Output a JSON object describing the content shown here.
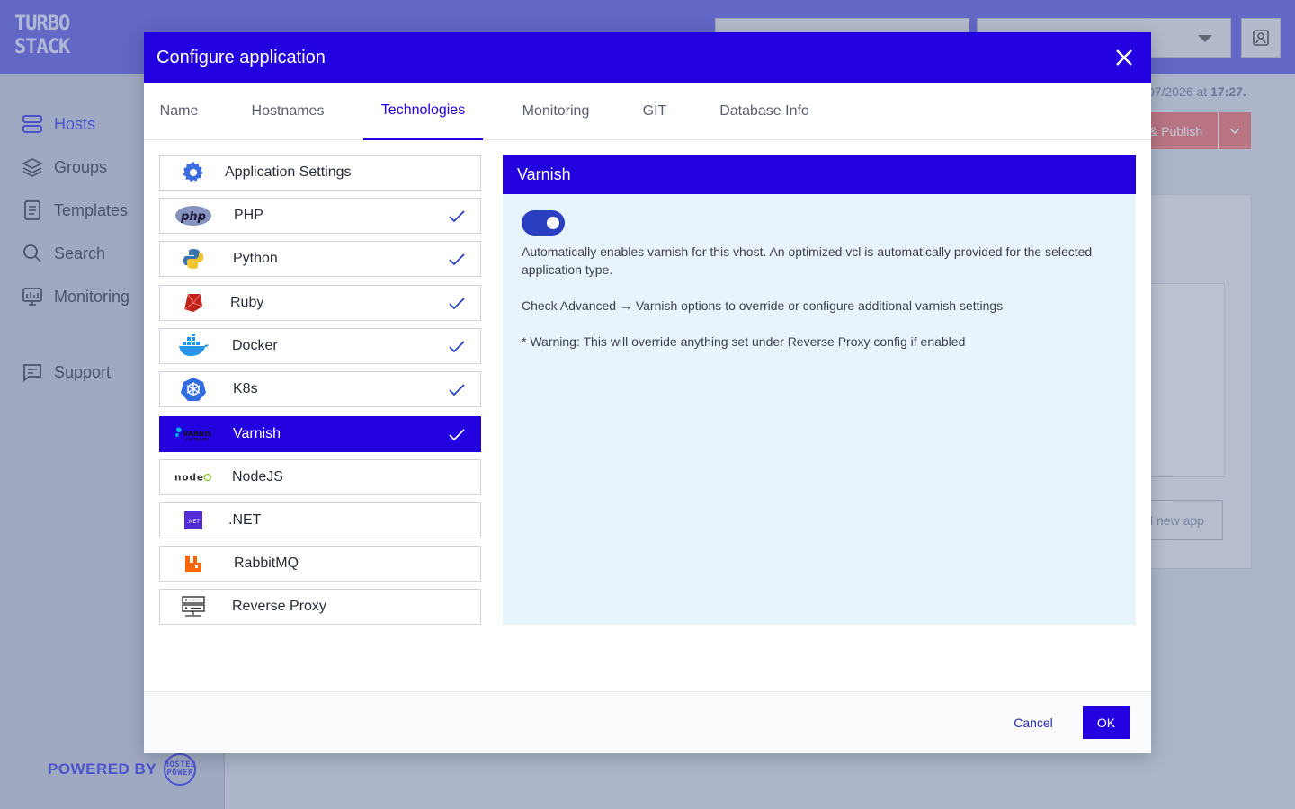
{
  "app": {
    "logo_text": "TURBO STACK",
    "powered_by": "POWERED BY",
    "powered_badge": "HOSTED POWER"
  },
  "sidebar": {
    "items": [
      {
        "label": "Hosts",
        "icon": "server-icon",
        "active": true
      },
      {
        "label": "Groups",
        "icon": "layers-icon"
      },
      {
        "label": "Templates",
        "icon": "document-icon"
      },
      {
        "label": "Search",
        "icon": "search-icon"
      },
      {
        "label": "Monitoring",
        "icon": "monitor-icon"
      },
      {
        "label": "Support",
        "icon": "chat-icon"
      }
    ]
  },
  "background": {
    "date_text": "07/2026",
    "date_at": "at",
    "time_text": "17:27.",
    "publish_label": "& Publish",
    "new_app_label": "l new app"
  },
  "modal": {
    "title": "Configure application",
    "tabs": [
      {
        "label": "Name"
      },
      {
        "label": "Hostnames"
      },
      {
        "label": "Technologies",
        "active": true
      },
      {
        "label": "Monitoring"
      },
      {
        "label": "GIT"
      },
      {
        "label": "Database Info"
      }
    ],
    "technologies": [
      {
        "label": "Application Settings",
        "icon": "gear-icon",
        "checked": false
      },
      {
        "label": "PHP",
        "icon": "php-logo-icon",
        "checked": true
      },
      {
        "label": "Python",
        "icon": "python-logo-icon",
        "checked": true
      },
      {
        "label": "Ruby",
        "icon": "ruby-logo-icon",
        "checked": true
      },
      {
        "label": "Docker",
        "icon": "docker-logo-icon",
        "checked": true
      },
      {
        "label": "K8s",
        "icon": "kubernetes-logo-icon",
        "checked": true
      },
      {
        "label": "Varnish",
        "icon": "varnish-logo-icon",
        "checked": true,
        "selected": true
      },
      {
        "label": "NodeJS",
        "icon": "nodejs-logo-icon",
        "checked": false
      },
      {
        "label": ".NET",
        "icon": "dotnet-logo-icon",
        "checked": false
      },
      {
        "label": "RabbitMQ",
        "icon": "rabbitmq-logo-icon",
        "checked": false
      },
      {
        "label": "Reverse Proxy",
        "icon": "server-rack-icon",
        "checked": false
      }
    ],
    "detail": {
      "title": "Varnish",
      "toggle_on": true,
      "description": "Automatically enables varnish for this vhost. An optimized vcl is automatically provided for the selected application type.",
      "advanced_note": "Check Advanced → Varnish options to override or configure additional varnish settings",
      "warning": "* Warning: This will override anything set under Reverse Proxy config if enabled"
    },
    "footer": {
      "cancel_label": "Cancel",
      "ok_label": "OK"
    }
  },
  "colors": {
    "primary": "#2200e0",
    "topbar": "#7b78e6",
    "detail_bg": "#e8f4fd"
  }
}
